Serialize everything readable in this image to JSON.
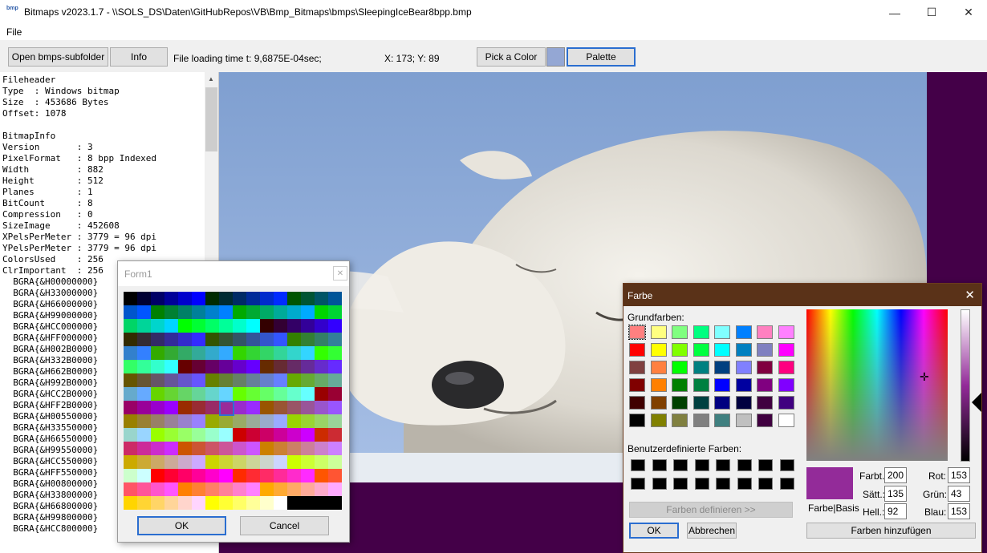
{
  "window": {
    "title": "Bitmaps v2023.1.7 - \\\\SOLS_DS\\Daten\\GitHubRepos\\VB\\Bmp_Bitmaps\\bmps\\SleepingIceBear8bpp.bmp",
    "icon_text": "bmp",
    "minimize": "—",
    "maximize": "☐",
    "close": "✕"
  },
  "menu": {
    "file": "File"
  },
  "toolbar": {
    "open_button": "Open bmps-subfolder",
    "info_button": "Info",
    "loading_time": "File loading time t: 9,6875E-04sec;",
    "coords": "X: 173; Y: 89",
    "pick_color_button": "Pick a Color",
    "palette_button": "Palette",
    "picked_color": "#94a7d4"
  },
  "info_text": [
    "Fileheader",
    "Type  : Windows bitmap",
    "Size  : 453686 Bytes",
    "Offset: 1078",
    "",
    "BitmapInfo",
    "Version       : 3",
    "PixelFormat   : 8 bpp Indexed",
    "Width         : 882",
    "Height        : 512",
    "Planes        : 1",
    "BitCount      : 8",
    "Compression   : 0",
    "SizeImage     : 452608",
    "XPelsPerMeter : 3779 = 96 dpi",
    "YPelsPerMeter : 3779 = 96 dpi",
    "ColorsUsed    : 256",
    "ClrImportant  : 256",
    "  BGRA{&H00000000}",
    "  BGRA{&H33000000}",
    "  BGRA{&H66000000}",
    "  BGRA{&H99000000}",
    "  BGRA{&HCC000000}",
    "  BGRA{&HFF000000}",
    "  BGRA{&H002B0000}",
    "  BGRA{&H332B0000}",
    "  BGRA{&H662B0000}",
    "  BGRA{&H992B0000}",
    "  BGRA{&HCC2B0000}",
    "  BGRA{&HFF2B0000}",
    "  BGRA{&H00550000}",
    "  BGRA{&H33550000}",
    "  BGRA{&H66550000}",
    "  BGRA{&H99550000}",
    "  BGRA{&HCC550000}",
    "  BGRA{&HFF550000}",
    "  BGRA{&H00800000}",
    "  BGRA{&H33800000}",
    "  BGRA{&H66800000}",
    "  BGRA{&H99800000}",
    "  BGRA{&HCC800000}"
  ],
  "form1": {
    "title": "Form1",
    "close": "✕",
    "ok_button": "OK",
    "cancel_button": "Cancel"
  },
  "farbe": {
    "title": "Farbe",
    "close": "✕",
    "basic_label": "Grundfarben:",
    "custom_label": "Benutzerdefinierte Farben:",
    "define_button": "Farben definieren >>",
    "ok_button": "OK",
    "cancel_button": "Abbrechen",
    "preview_label": "Farbe|Basis",
    "add_button": "Farben hinzufügen",
    "hue_label": "Farbt.:",
    "sat_label": "Sätt.:",
    "lum_label": "Hell.:",
    "red_label": "Rot:",
    "green_label": "Grün:",
    "blue_label": "Blau:",
    "hue": "200",
    "sat": "135",
    "lum": "92",
    "red": "153",
    "green": "43",
    "blue": "153",
    "selected_color": "#932b99",
    "basic_colors": [
      "#ff8080",
      "#ffff80",
      "#80ff80",
      "#00ff80",
      "#80ffff",
      "#0080ff",
      "#ff80c0",
      "#ff80ff",
      "#ff0000",
      "#ffff00",
      "#80ff00",
      "#00ff40",
      "#00ffff",
      "#0080c0",
      "#8080c0",
      "#ff00ff",
      "#804040",
      "#ff8040",
      "#00ff00",
      "#008080",
      "#004080",
      "#8080ff",
      "#800040",
      "#ff0080",
      "#800000",
      "#ff8000",
      "#008000",
      "#008040",
      "#0000ff",
      "#0000a0",
      "#800080",
      "#8000ff",
      "#400000",
      "#804000",
      "#004000",
      "#004040",
      "#000080",
      "#000040",
      "#400040",
      "#400080",
      "#000000",
      "#808000",
      "#808040",
      "#808080",
      "#408080",
      "#c0c0c0",
      "#400040",
      "#ffffff"
    ]
  }
}
